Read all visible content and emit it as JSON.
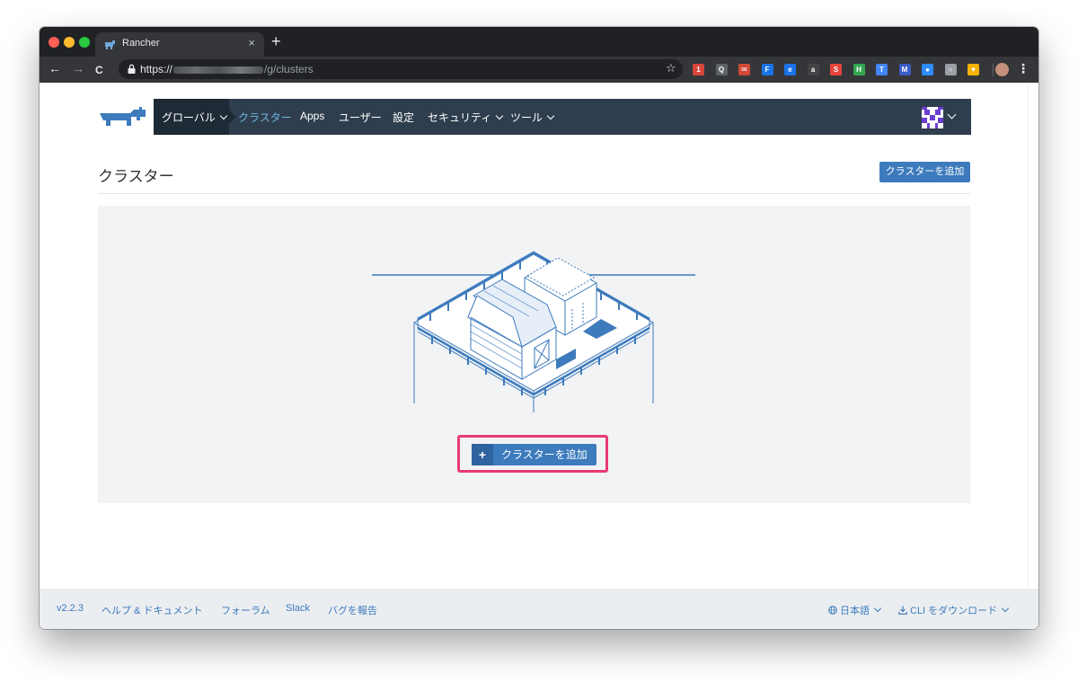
{
  "browser": {
    "tab_title": "Rancher",
    "tab_close": "×",
    "new_tab": "+",
    "url_prefix": "https://",
    "url_path": "/g/clusters",
    "back": "←",
    "forward": "→",
    "reload": "C",
    "bookmark": "☆",
    "menu": "⋮",
    "extensions": [
      {
        "name": "ext-1",
        "glyph": "1",
        "color": "#d9453a"
      },
      {
        "name": "ext-2",
        "glyph": "Q",
        "color": "#5f6368"
      },
      {
        "name": "ext-3",
        "glyph": "✉",
        "color": "#d14836"
      },
      {
        "name": "ext-4",
        "glyph": "F",
        "color": "#1a73e8"
      },
      {
        "name": "ext-5",
        "glyph": "e",
        "color": "#1a73e8"
      },
      {
        "name": "ext-6",
        "glyph": "a",
        "color": "#444444"
      },
      {
        "name": "ext-7",
        "glyph": "S",
        "color": "#e8453c"
      },
      {
        "name": "ext-8",
        "glyph": "H",
        "color": "#34a853"
      },
      {
        "name": "ext-9",
        "glyph": "T",
        "color": "#4285f4"
      },
      {
        "name": "ext-10",
        "glyph": "M",
        "color": "#3b5cc7"
      },
      {
        "name": "ext-11",
        "glyph": "●",
        "color": "#2d8cff"
      },
      {
        "name": "ext-12",
        "glyph": "○",
        "color": "#9aa0a6"
      },
      {
        "name": "ext-13",
        "glyph": "♥",
        "color": "#f6b400"
      }
    ]
  },
  "nav": {
    "global": "グローバル",
    "items": [
      {
        "label": "クラスター",
        "active": true
      },
      {
        "label": "Apps",
        "active": false
      },
      {
        "label": "ユーザー",
        "active": false
      },
      {
        "label": "設定",
        "active": false
      },
      {
        "label": "セキュリティ",
        "active": false,
        "dropdown": true
      },
      {
        "label": "ツール",
        "active": false,
        "dropdown": true
      }
    ]
  },
  "main": {
    "title": "クラスター",
    "add_cluster_top": "クラスターを追加",
    "add_cluster_main": "クラスターを追加",
    "plus": "+"
  },
  "footer": {
    "version": "v2.2.3",
    "help": "ヘルプ & ドキュメント",
    "forum": "フォーラム",
    "slack": "Slack",
    "bug": "バグを報告",
    "language": "日本語",
    "cli": "CLI をダウンロード"
  },
  "colors": {
    "accent": "#3d7bbd",
    "navbar": "#2f3e4e",
    "highlight": "#e83b74"
  }
}
